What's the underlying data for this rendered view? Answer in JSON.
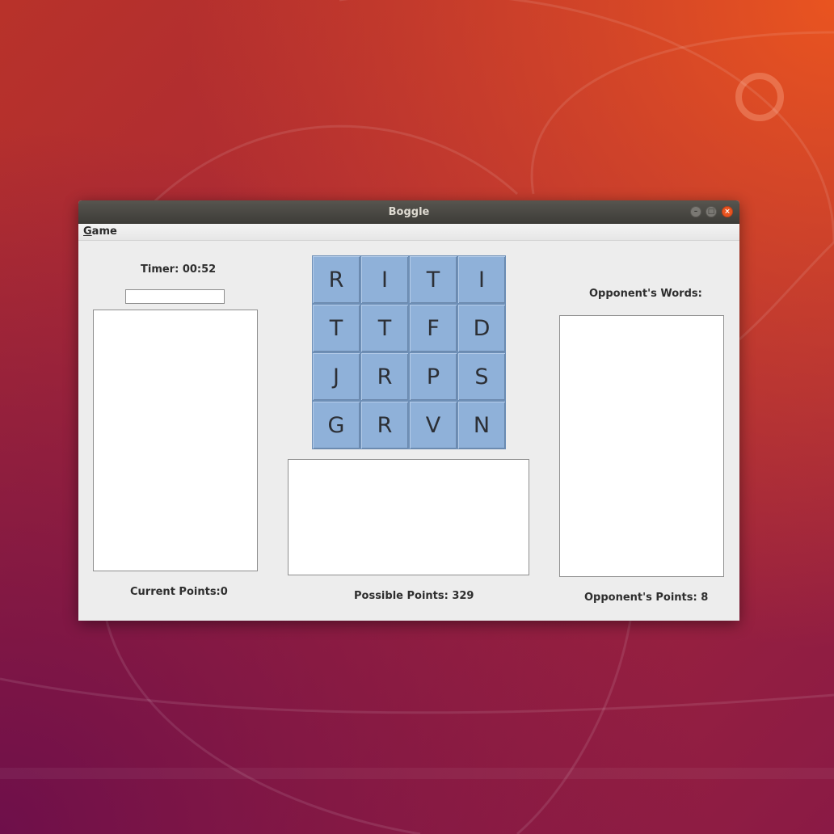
{
  "window": {
    "title": "Boggle"
  },
  "menu": {
    "game_label": "Game"
  },
  "timer": {
    "label": "Timer:",
    "value": "00:52"
  },
  "word_input": {
    "value": ""
  },
  "board": {
    "tiles": [
      "R",
      "I",
      "T",
      "I",
      "T",
      "T",
      "F",
      "D",
      "J",
      "R",
      "P",
      "S",
      "G",
      "R",
      "V",
      "N"
    ]
  },
  "current_points": "Current Points:0",
  "possible_points": "Possible Points: 329",
  "opponent": {
    "words_label": "Opponent's Words:",
    "points": "Opponent's Points: 8"
  },
  "colors": {
    "tile": "#8fb1d9",
    "accent": "#e95420"
  }
}
